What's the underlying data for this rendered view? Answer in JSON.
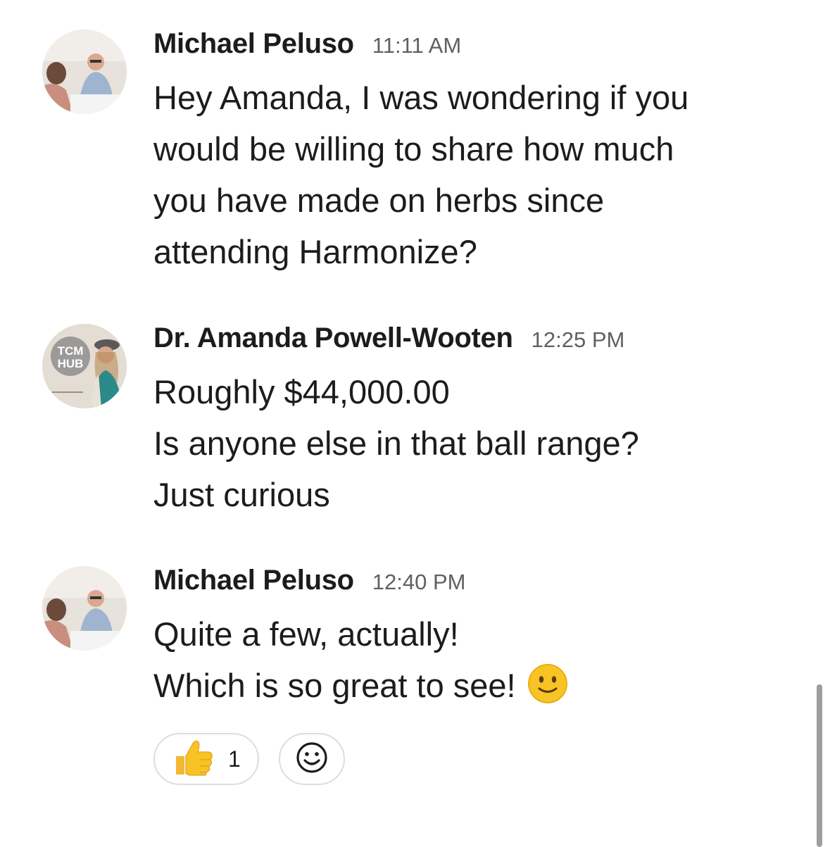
{
  "messages": [
    {
      "author": "Michael Peluso",
      "time": "11:11 AM",
      "avatar": "michael-peluso-photo",
      "lines": [
        "Hey Amanda, I was wondering if you",
        "would be willing to share how much",
        "you have made on herbs since",
        "attending Harmonize?"
      ]
    },
    {
      "author": "Dr. Amanda Powell-Wooten",
      "time": "12:25 PM",
      "avatar": "tcm-hub-photo",
      "avatar_logo_top": "TCM",
      "avatar_logo_bottom": "HUB",
      "lines": [
        "Roughly $44,000.00",
        "Is anyone else in that ball range?",
        "Just curious"
      ]
    },
    {
      "author": "Michael Peluso",
      "time": "12:40 PM",
      "avatar": "michael-peluso-photo",
      "lines": [
        "Quite a few, actually!",
        "Which is so great to see!"
      ],
      "trailing_emoji": "slightly-smiling-face-emoji",
      "reactions": [
        {
          "emoji": "thumbs-up-emoji",
          "count": "1"
        }
      ],
      "add_reaction_icon": "add-reaction-icon"
    }
  ],
  "colors": {
    "text": "#1d1c1d",
    "timestamp": "#616061",
    "pill_border": "#dddddd",
    "scrollbar": "#9e9e9e"
  }
}
